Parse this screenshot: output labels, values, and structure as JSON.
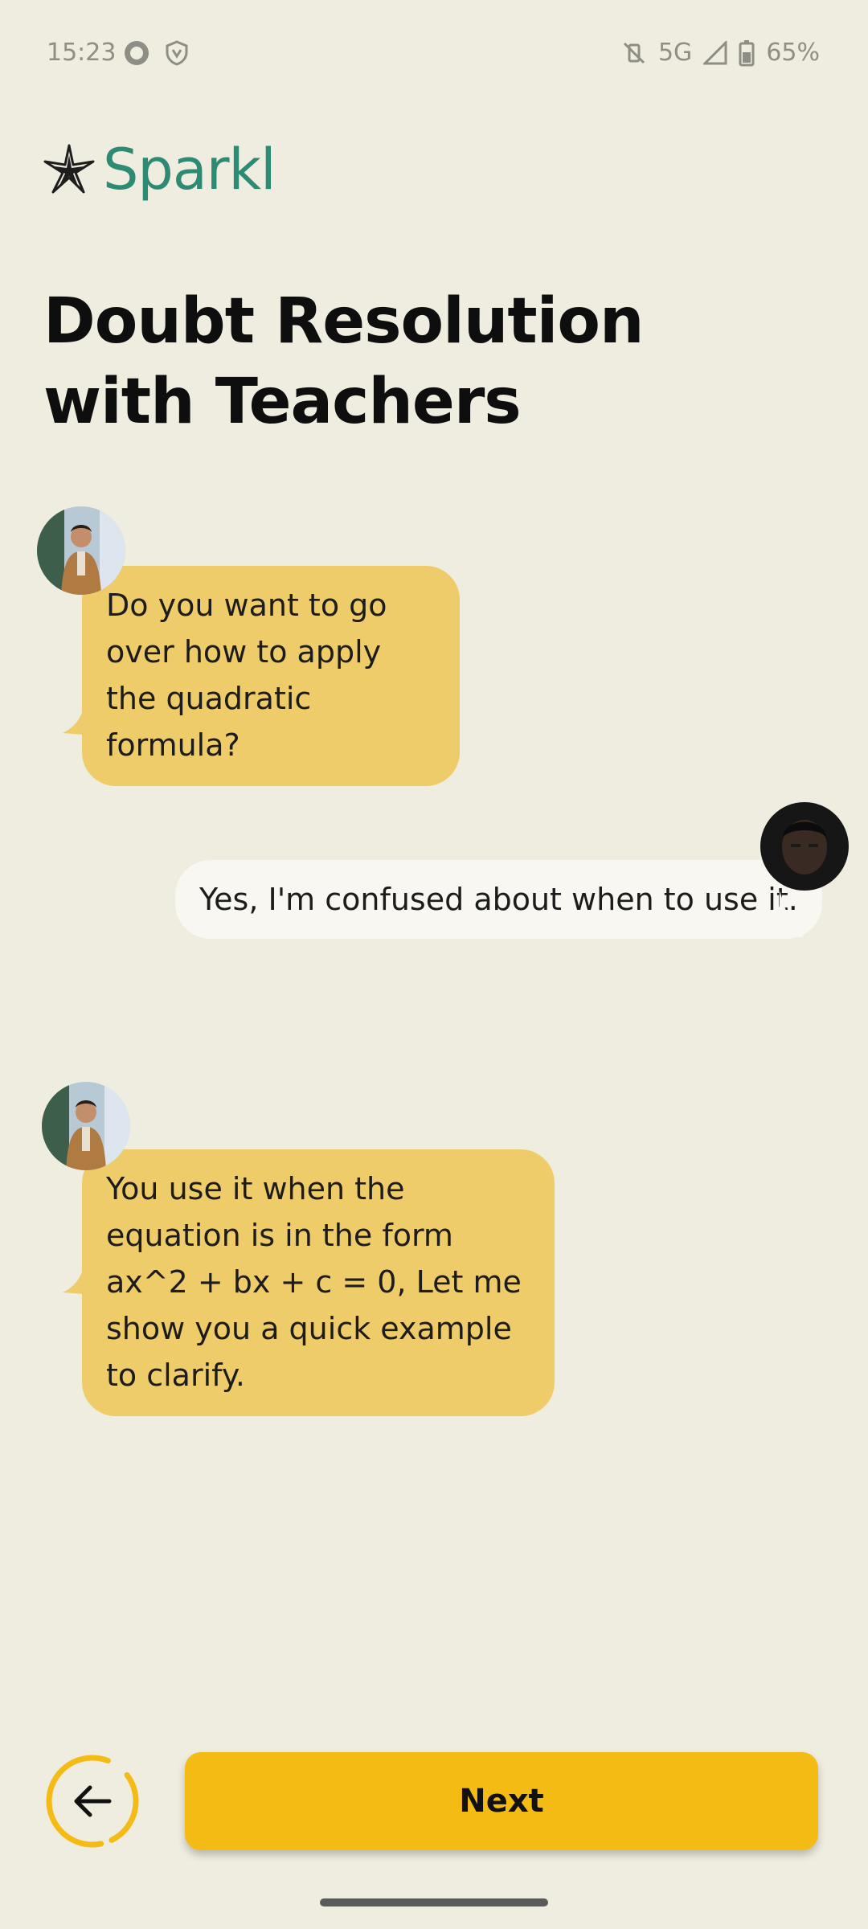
{
  "status_bar": {
    "time": "15:23",
    "network": "5G",
    "battery": "65%",
    "icons": [
      "record-icon",
      "shield-icon",
      "vibrate-off-icon",
      "signal-icon",
      "battery-icon"
    ]
  },
  "brand": {
    "name": "Sparkl",
    "color": "#2D8A73"
  },
  "page": {
    "title_line1": "Doubt Resolution",
    "title_line2": "with Teachers"
  },
  "chat": {
    "messages": [
      {
        "sender": "teacher",
        "text": "Do you want to go over how to apply the quadratic formula?"
      },
      {
        "sender": "student",
        "text": "Yes, I'm confused about when to use it."
      },
      {
        "sender": "teacher",
        "text": "You use it when the equation is in the form ax^2 + bx + c = 0, Let me show you a quick example to clarify."
      }
    ]
  },
  "controls": {
    "next_label": "Next",
    "back_icon": "arrow-left-icon"
  },
  "colors": {
    "background": "#EFEDDF",
    "teacher_bubble": "#EFCC6A",
    "student_bubble": "#F8F7F1",
    "accent": "#F4BB15"
  }
}
